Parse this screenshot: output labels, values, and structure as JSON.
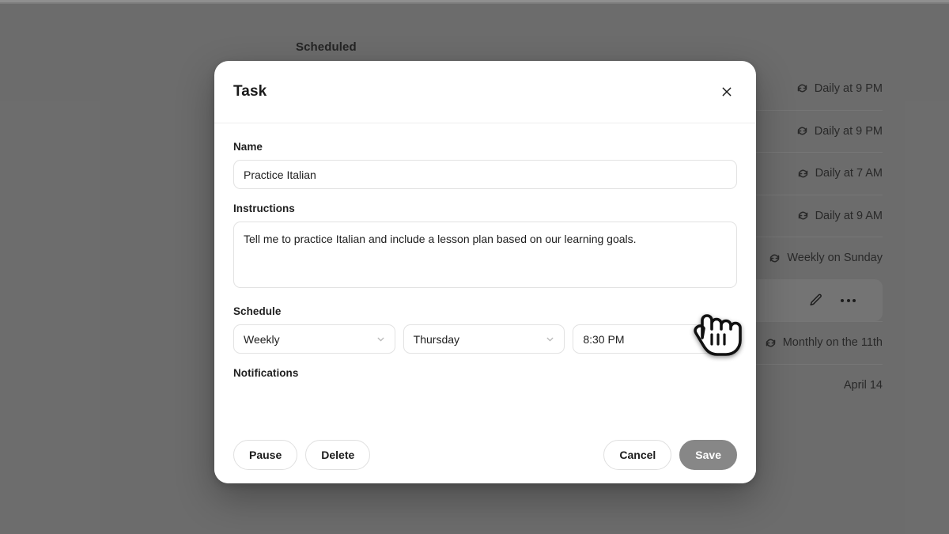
{
  "background": {
    "page_title": "Scheduled",
    "rows": [
      {
        "schedule": "Daily at 9 PM",
        "icon": "refresh-icon",
        "state": "normal"
      },
      {
        "schedule": "Daily at 9 PM",
        "icon": "refresh-icon",
        "state": "normal"
      },
      {
        "schedule": "Daily at 7 AM",
        "icon": "refresh-icon",
        "state": "normal"
      },
      {
        "schedule": "Daily at 9 AM",
        "icon": "refresh-icon",
        "state": "normal"
      },
      {
        "schedule": "Weekly on Sunday",
        "icon": "refresh-icon",
        "state": "normal"
      },
      {
        "schedule": "",
        "icon": "",
        "state": "hovered",
        "actions": [
          "edit-pencil-icon",
          "more-options-icon"
        ]
      },
      {
        "schedule": "Monthly on the 11th",
        "icon": "refresh-icon",
        "state": "normal"
      },
      {
        "schedule": "April 14",
        "icon": "",
        "state": "normal"
      }
    ]
  },
  "modal": {
    "title": "Task",
    "close_icon": "close-icon",
    "fields": {
      "name": {
        "label": "Name",
        "value": "Practice Italian",
        "placeholder": "Name"
      },
      "instructions": {
        "label": "Instructions",
        "value": "Tell me to practice Italian and include a lesson plan based on our learning goals.",
        "placeholder": "Instructions"
      },
      "schedule": {
        "label": "Schedule",
        "frequency": {
          "value": "Weekly",
          "icon": "chevron-down-icon"
        },
        "day": {
          "value": "Thursday",
          "icon": "chevron-down-icon"
        },
        "time": {
          "value": "8:30 PM",
          "icon": "chevron-down-icon"
        }
      },
      "notifications": {
        "label": "Notifications"
      }
    },
    "footer": {
      "pause_label": "Pause",
      "delete_label": "Delete",
      "cancel_label": "Cancel",
      "save_label": "Save"
    }
  },
  "colors": {
    "backdrop": "#7e7e7e",
    "modal_bg": "#ffffff",
    "primary_button": "#878787",
    "border": "#e2e2e2",
    "text": "#1d1d1d"
  },
  "cursor": {
    "type": "pointer-hand-cursor"
  }
}
